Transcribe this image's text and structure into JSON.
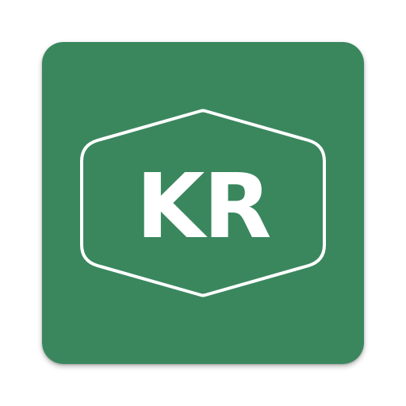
{
  "app_icon": {
    "monogram": "KR",
    "icon_name": "kr-badge-logo-icon",
    "colors": {
      "background": "#3a875e",
      "foreground": "#ffffff",
      "page": "#ffffff"
    }
  }
}
